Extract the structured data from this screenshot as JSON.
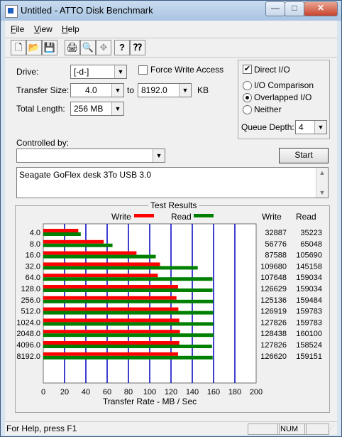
{
  "window": {
    "title": "Untitled - ATTO Disk Benchmark",
    "minimize": "—",
    "maximize": "□",
    "close": "✕"
  },
  "menu": [
    {
      "label": "File",
      "key": "F",
      "rest": "ile"
    },
    {
      "label": "View",
      "key": "V",
      "rest": "iew"
    },
    {
      "label": "Help",
      "key": "H",
      "rest": "elp"
    }
  ],
  "toolbar": {
    "icons": [
      "new-file-icon",
      "open-folder-icon",
      "save-icon",
      "print-icon",
      "print-preview-icon",
      "move-icon",
      "help-question-icon",
      "context-help-icon"
    ],
    "glyphs": [
      "🗋",
      "📂",
      "💾",
      "🖨",
      "🔍",
      "✥",
      "?",
      "⁇"
    ]
  },
  "settings": {
    "drive_label": "Drive:",
    "drive_value": "[-d-]",
    "transfer_size_label": "Transfer Size:",
    "transfer_from": "4.0",
    "to_label": "to",
    "transfer_to": "8192.0",
    "kb_label": "KB",
    "total_length_label": "Total Length:",
    "total_length_value": "256 MB",
    "force_write_label": "Force Write Access",
    "force_write_checked": false,
    "direct_io_label": "Direct I/O",
    "direct_io_checked": true,
    "io_comparison_label": "I/O Comparison",
    "overlapped_label": "Overlapped I/O",
    "neither_label": "Neither",
    "selected_mode": "overlapped",
    "queue_depth_label": "Queue Depth:",
    "queue_depth_value": "4",
    "controlled_by_label": "Controlled by:",
    "controlled_by_value": "",
    "start_label": "Start"
  },
  "description": "Seagate GoFlex desk 3To USB 3.0",
  "results": {
    "group_label": "Test Results",
    "legend_write": "Write",
    "legend_read": "Read",
    "col_write": "Write",
    "col_read": "Read",
    "write_color": "#ff0000",
    "read_color": "#008000",
    "grid_color": "#0000c0"
  },
  "chart_data": {
    "type": "bar",
    "orientation": "horizontal",
    "title": "Test Results",
    "xlabel": "Transfer Rate - MB / Sec",
    "ylabel": "",
    "xlim": [
      0,
      200
    ],
    "x_ticks": [
      "0",
      "20",
      "40",
      "60",
      "80",
      "100",
      "120",
      "140",
      "160",
      "180",
      "200"
    ],
    "categories": [
      "4.0",
      "8.0",
      "16.0",
      "32.0",
      "64.0",
      "128.0",
      "256.0",
      "512.0",
      "1024.0",
      "2048.0",
      "4096.0",
      "8192.0"
    ],
    "series": [
      {
        "name": "Write",
        "values": [
          32.887,
          56.776,
          87.588,
          109.68,
          107.648,
          126.629,
          125.136,
          126.919,
          127.826,
          128.438,
          127.826,
          126.62
        ]
      },
      {
        "name": "Read",
        "values": [
          35.223,
          65.048,
          105.69,
          145.158,
          159.034,
          159.034,
          159.484,
          159.783,
          159.783,
          160.1,
          158.524,
          159.151
        ]
      }
    ],
    "write_labels": [
      "32887",
      "56776",
      "87588",
      "109680",
      "107648",
      "126629",
      "125136",
      "126919",
      "127826",
      "128438",
      "127826",
      "126620"
    ],
    "read_labels": [
      "35223",
      "65048",
      "105690",
      "145158",
      "159034",
      "159034",
      "159484",
      "159783",
      "159783",
      "160100",
      "158524",
      "159151"
    ],
    "grid": true,
    "legend": "top-center"
  },
  "status": {
    "help_text": "For Help, press F1",
    "num": "NUM"
  }
}
